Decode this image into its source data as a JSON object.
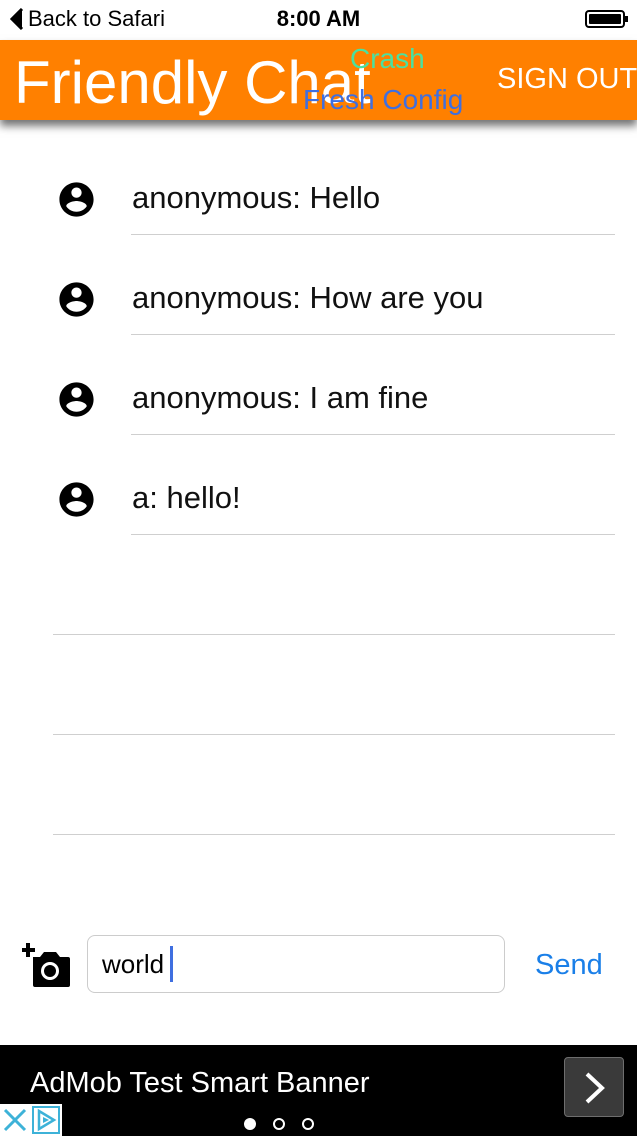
{
  "status_bar": {
    "back_label": "Back to Safari",
    "time": "8:00 AM"
  },
  "app_bar": {
    "title": "Friendly Chat",
    "crash_label": "Crash",
    "fresh_config_label": "Fresh Config",
    "sign_out_label": "SIGN OUT"
  },
  "messages": [
    {
      "text": "anonymous: Hello",
      "avatar": "account-circle-icon"
    },
    {
      "text": "anonymous: How are you",
      "avatar": "account-circle-icon"
    },
    {
      "text": "anonymous: I am fine",
      "avatar": "account-circle-icon"
    },
    {
      "text": "a: hello!",
      "avatar": "account-circle-icon"
    }
  ],
  "composer": {
    "input_value": "world",
    "send_label": "Send",
    "camera_icon": "add-a-photo-icon"
  },
  "ad": {
    "text": "AdMob Test Smart Banner",
    "page_count": 3,
    "active_page": 1
  },
  "colors": {
    "app_bar": "#ff8000",
    "crash": "#4be0a0",
    "fresh_config": "#3f6fe0",
    "send": "#1a7fe8"
  }
}
